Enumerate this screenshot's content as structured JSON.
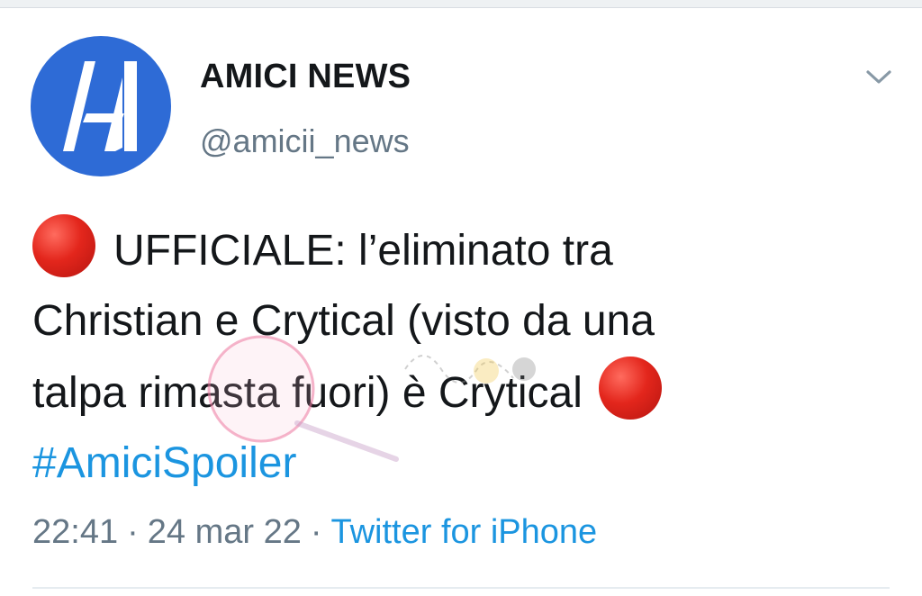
{
  "header": {
    "display_name": "AMICI NEWS",
    "handle": "@amicii_news",
    "avatar_icon": "amici-logo-icon",
    "menu_icon": "chevron-down-icon"
  },
  "tweet": {
    "lines": [
      "UFFICIALE: l’eliminato tra",
      "Christian e Crytical (visto da una",
      "talpa rimasta fuori) è Crytical",
      "#AmiciSpoiler"
    ],
    "emoji_icon": "red-circle-icon"
  },
  "meta": {
    "time": "22:41",
    "separator": "·",
    "date": "24 mar 22",
    "source": "Twitter for iPhone"
  },
  "colors": {
    "avatar_bg": "#2e6bd6",
    "link": "#1b95e0",
    "text": "#14171a",
    "muted": "#657786",
    "emoji_red": "#e3261c"
  }
}
